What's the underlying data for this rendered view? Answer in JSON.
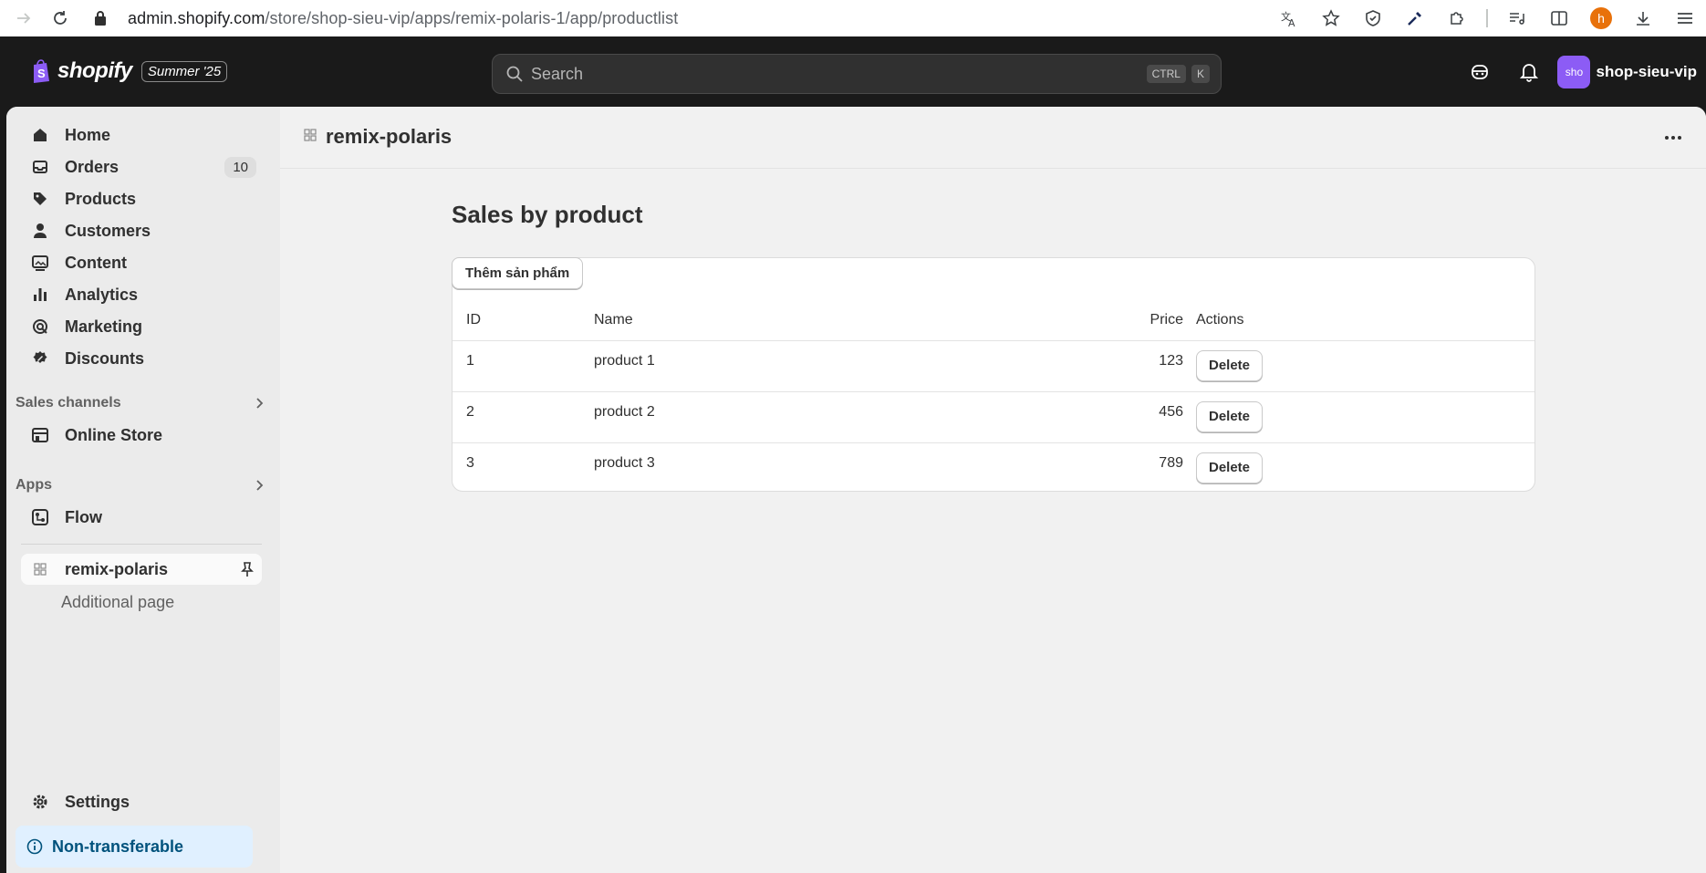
{
  "browser": {
    "url_host": "admin.shopify.com",
    "url_path": "/store/shop-sieu-vip/apps/remix-polaris-1/app/productlist",
    "profile_initial": "h"
  },
  "topbar": {
    "logo": "shopify",
    "edition": "Summer '25",
    "search_placeholder": "Search",
    "shortcut_keys": [
      "CTRL",
      "K"
    ],
    "store_avatar": "sho",
    "store_name": "shop-sieu-vip"
  },
  "sidebar": {
    "items": [
      {
        "label": "Home",
        "icon": "home-icon"
      },
      {
        "label": "Orders",
        "icon": "inbox-icon",
        "badge": "10"
      },
      {
        "label": "Products",
        "icon": "tag-icon"
      },
      {
        "label": "Customers",
        "icon": "person-icon"
      },
      {
        "label": "Content",
        "icon": "image-icon"
      },
      {
        "label": "Analytics",
        "icon": "bar-chart-icon"
      },
      {
        "label": "Marketing",
        "icon": "target-icon"
      },
      {
        "label": "Discounts",
        "icon": "discount-icon"
      }
    ],
    "sales_channels_label": "Sales channels",
    "online_store_label": "Online Store",
    "apps_label": "Apps",
    "flow_label": "Flow",
    "active_app_label": "remix-polaris",
    "additional_page_label": "Additional page",
    "settings_label": "Settings",
    "non_transferable_label": "Non-transferable"
  },
  "app": {
    "title": "remix-polaris",
    "page_title": "Sales by product",
    "add_button_label": "Thêm sản phẩm",
    "columns": [
      "ID",
      "Name",
      "Price",
      "Actions"
    ],
    "delete_label": "Delete",
    "rows": [
      {
        "id": "1",
        "name": "product 1",
        "price": "123"
      },
      {
        "id": "2",
        "name": "product 2",
        "price": "456"
      },
      {
        "id": "3",
        "name": "product 3",
        "price": "789"
      }
    ]
  },
  "colors": {
    "topbar_bg": "#1a1a1a",
    "frame_bg": "#f1f1f1",
    "sidebar_bg": "#ebebeb",
    "avatar_purple": "#8c5cf5",
    "profile_orange": "#e8710a",
    "info_bg": "#e0f0ff"
  }
}
